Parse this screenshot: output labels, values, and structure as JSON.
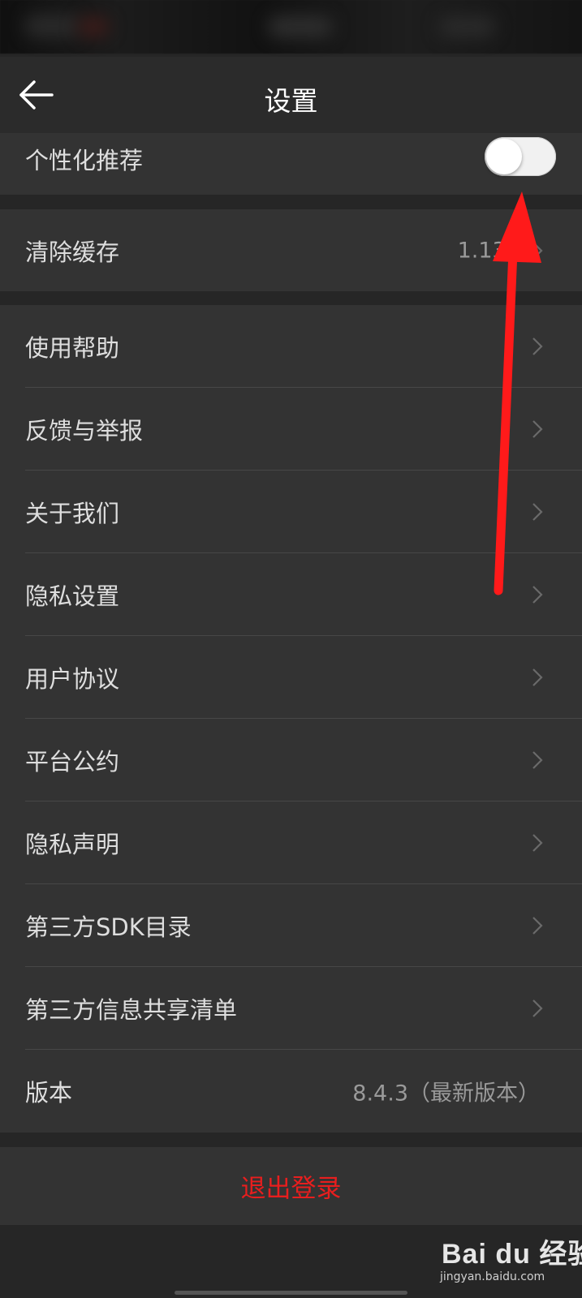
{
  "header": {
    "title": "设置"
  },
  "sections": {
    "personalization": {
      "label": "个性化推荐",
      "toggle_on": false
    },
    "cache": {
      "label": "清除缓存",
      "value": "1.13M"
    },
    "menu": [
      {
        "label": "使用帮助"
      },
      {
        "label": "反馈与举报"
      },
      {
        "label": "关于我们"
      },
      {
        "label": "隐私设置"
      },
      {
        "label": "用户协议"
      },
      {
        "label": "平台公约"
      },
      {
        "label": "隐私声明"
      },
      {
        "label": "第三方SDK目录"
      },
      {
        "label": "第三方信息共享清单"
      },
      {
        "label": "版本",
        "value": "8.4.3（最新版本）"
      }
    ]
  },
  "logout": {
    "label": "退出登录"
  },
  "watermark": {
    "brand": "Bai du 经验",
    "url": "jingyan.baidu.com"
  },
  "colors": {
    "background": "#262626",
    "card": "#333333",
    "logout_text": "#e81e1e",
    "annotation_arrow": "#ff1a1a"
  },
  "icons": {
    "back": "left-arrow",
    "chevron": "chevron-right",
    "toggle": "switch"
  }
}
